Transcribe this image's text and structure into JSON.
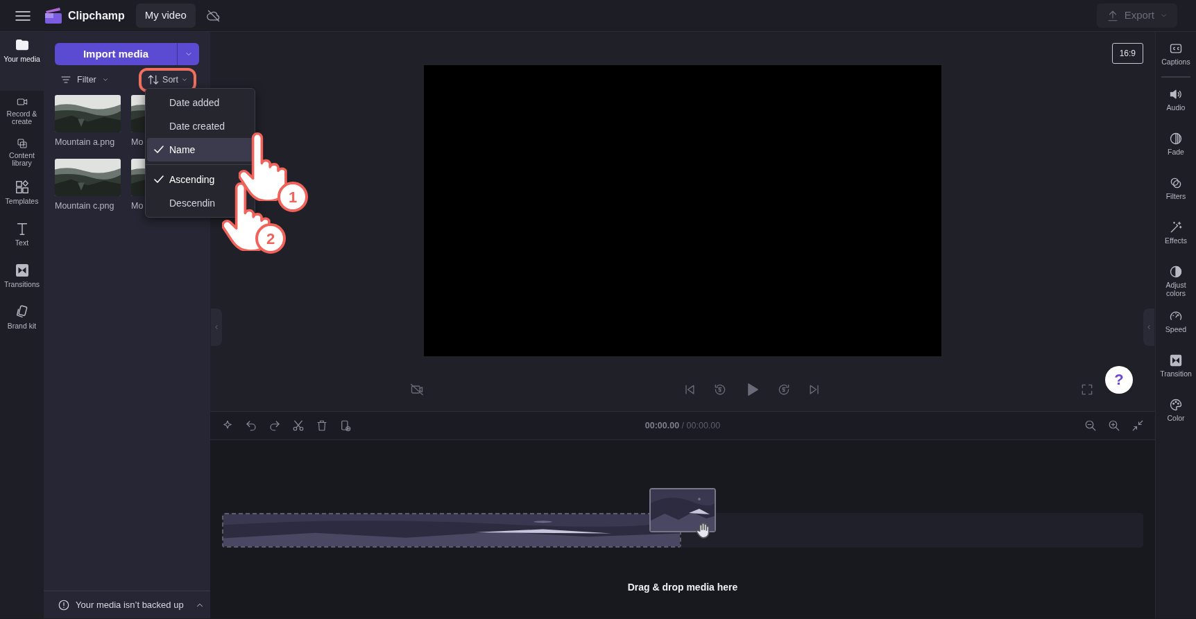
{
  "topbar": {
    "app_name": "Clipchamp",
    "project_title": "My video",
    "export_label": "Export"
  },
  "left_rail": [
    {
      "label": "Your media",
      "selected": true
    },
    {
      "label": "Record & create",
      "selected": false
    },
    {
      "label": "Content library",
      "selected": false
    },
    {
      "label": "Templates",
      "selected": false
    },
    {
      "label": "Text",
      "selected": false
    },
    {
      "label": "Transitions",
      "selected": false
    },
    {
      "label": "Brand kit",
      "selected": false
    }
  ],
  "media_panel": {
    "import_label": "Import media",
    "filter_label": "Filter",
    "sort_label": "Sort",
    "sort_highlighted": true,
    "items": [
      {
        "label": "Mountain a.png"
      },
      {
        "label": "Mo"
      },
      {
        "label": "Mountain c.png"
      },
      {
        "label": "Mo"
      }
    ],
    "backup_notice": "Your media isn’t backed up"
  },
  "sort_menu": {
    "sort_by": [
      {
        "label": "Date added",
        "selected": false,
        "hovered": false
      },
      {
        "label": "Date created",
        "selected": false,
        "hovered": false
      },
      {
        "label": "Name",
        "selected": true,
        "hovered": true
      }
    ],
    "order": [
      {
        "label": "Ascending",
        "selected": true
      },
      {
        "label": "Descendin",
        "selected": false
      }
    ]
  },
  "preview": {
    "aspect_ratio": "16:9",
    "help_label": "?"
  },
  "timeline": {
    "current_time": "00:00.00",
    "total_time": "/ 00:00.00",
    "drop_hint": "Drag & drop media here"
  },
  "right_rail": [
    {
      "label": "Captions"
    },
    {
      "label": "Audio"
    },
    {
      "label": "Fade"
    },
    {
      "label": "Filters"
    },
    {
      "label": "Effects"
    },
    {
      "label": "Adjust colors"
    },
    {
      "label": "Speed"
    },
    {
      "label": "Transition"
    },
    {
      "label": "Color"
    }
  ],
  "annotations": [
    {
      "number": "1"
    },
    {
      "number": "2"
    }
  ]
}
